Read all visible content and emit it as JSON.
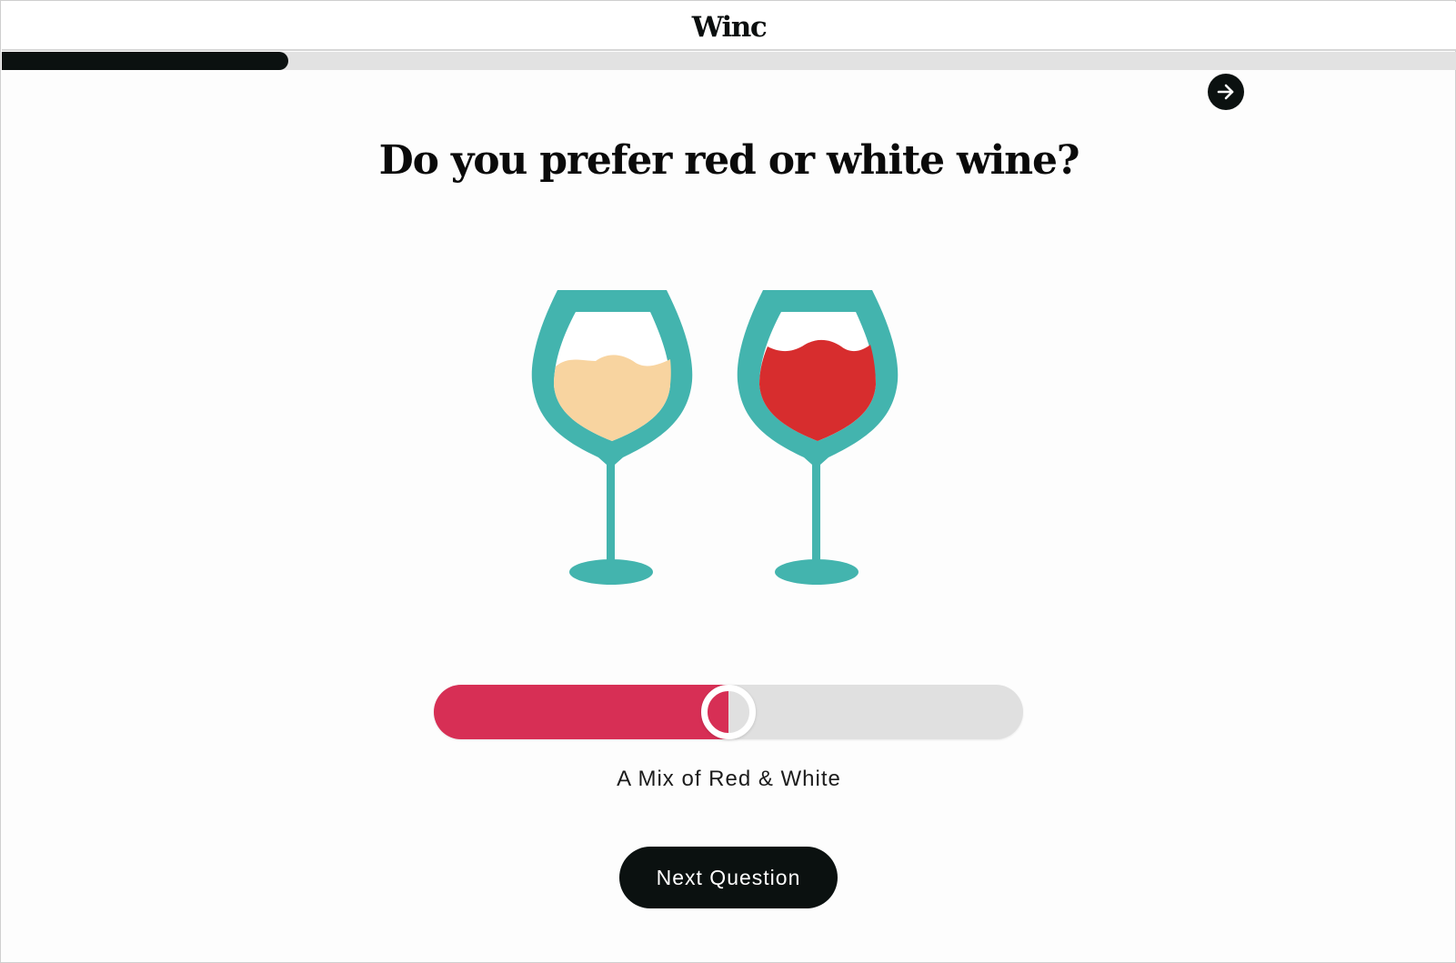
{
  "brand": {
    "logo_text": "Winc"
  },
  "progress": {
    "fraction": 0.197
  },
  "skip": {
    "icon": "arrow-right-icon"
  },
  "question": {
    "title": "Do you prefer red or white wine?"
  },
  "illustration": {
    "icon": "wine-glasses-icon",
    "colors": {
      "glass": "#43b4ae",
      "white_wine": "#f8d4a0",
      "red_wine": "#d72d2e"
    }
  },
  "slider": {
    "value_fraction": 0.5,
    "label": "A Mix of Red & White",
    "colors": {
      "fill": "#d72f55",
      "track": "#e0e0e0"
    }
  },
  "actions": {
    "next_label": "Next Question"
  }
}
